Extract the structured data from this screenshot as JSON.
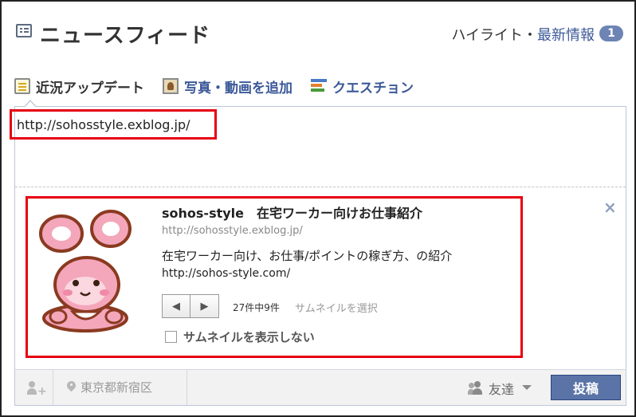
{
  "header": {
    "title": "ニュースフィード",
    "highlight": "ハイライト・",
    "latest": "最新情報",
    "badge": "1"
  },
  "composer": {
    "tabs": [
      {
        "label": "近況アップデート",
        "icon": "note-icon"
      },
      {
        "label": "写真・動画を追加",
        "icon": "photo-icon"
      },
      {
        "label": "クエスチョン",
        "icon": "question-icon"
      }
    ],
    "url_value": "http://sohosstyle.exblog.jp/"
  },
  "preview": {
    "title": "sohos-style　在宅ワーカー向けお仕事紹介",
    "url": "http://sohosstyle.exblog.jp/",
    "description": "在宅ワーカー向け、お仕事/ポイントの稼ぎ方、の紹介",
    "site": "http://sohos-style.com/",
    "prev_symbol": "◀",
    "next_symbol": "▶",
    "count": "27件中9件",
    "choose_thumbnail": "サムネイルを選択",
    "no_thumbnail": "サムネイルを表示しない",
    "close_symbol": "×"
  },
  "footer": {
    "location": "東京都新宿区",
    "audience": "友達",
    "post_label": "投稿"
  },
  "colors": {
    "accent": "#3b5998",
    "highlight_border": "#e60012",
    "post_button": "#5b74a8",
    "badge": "#6d84b4"
  }
}
